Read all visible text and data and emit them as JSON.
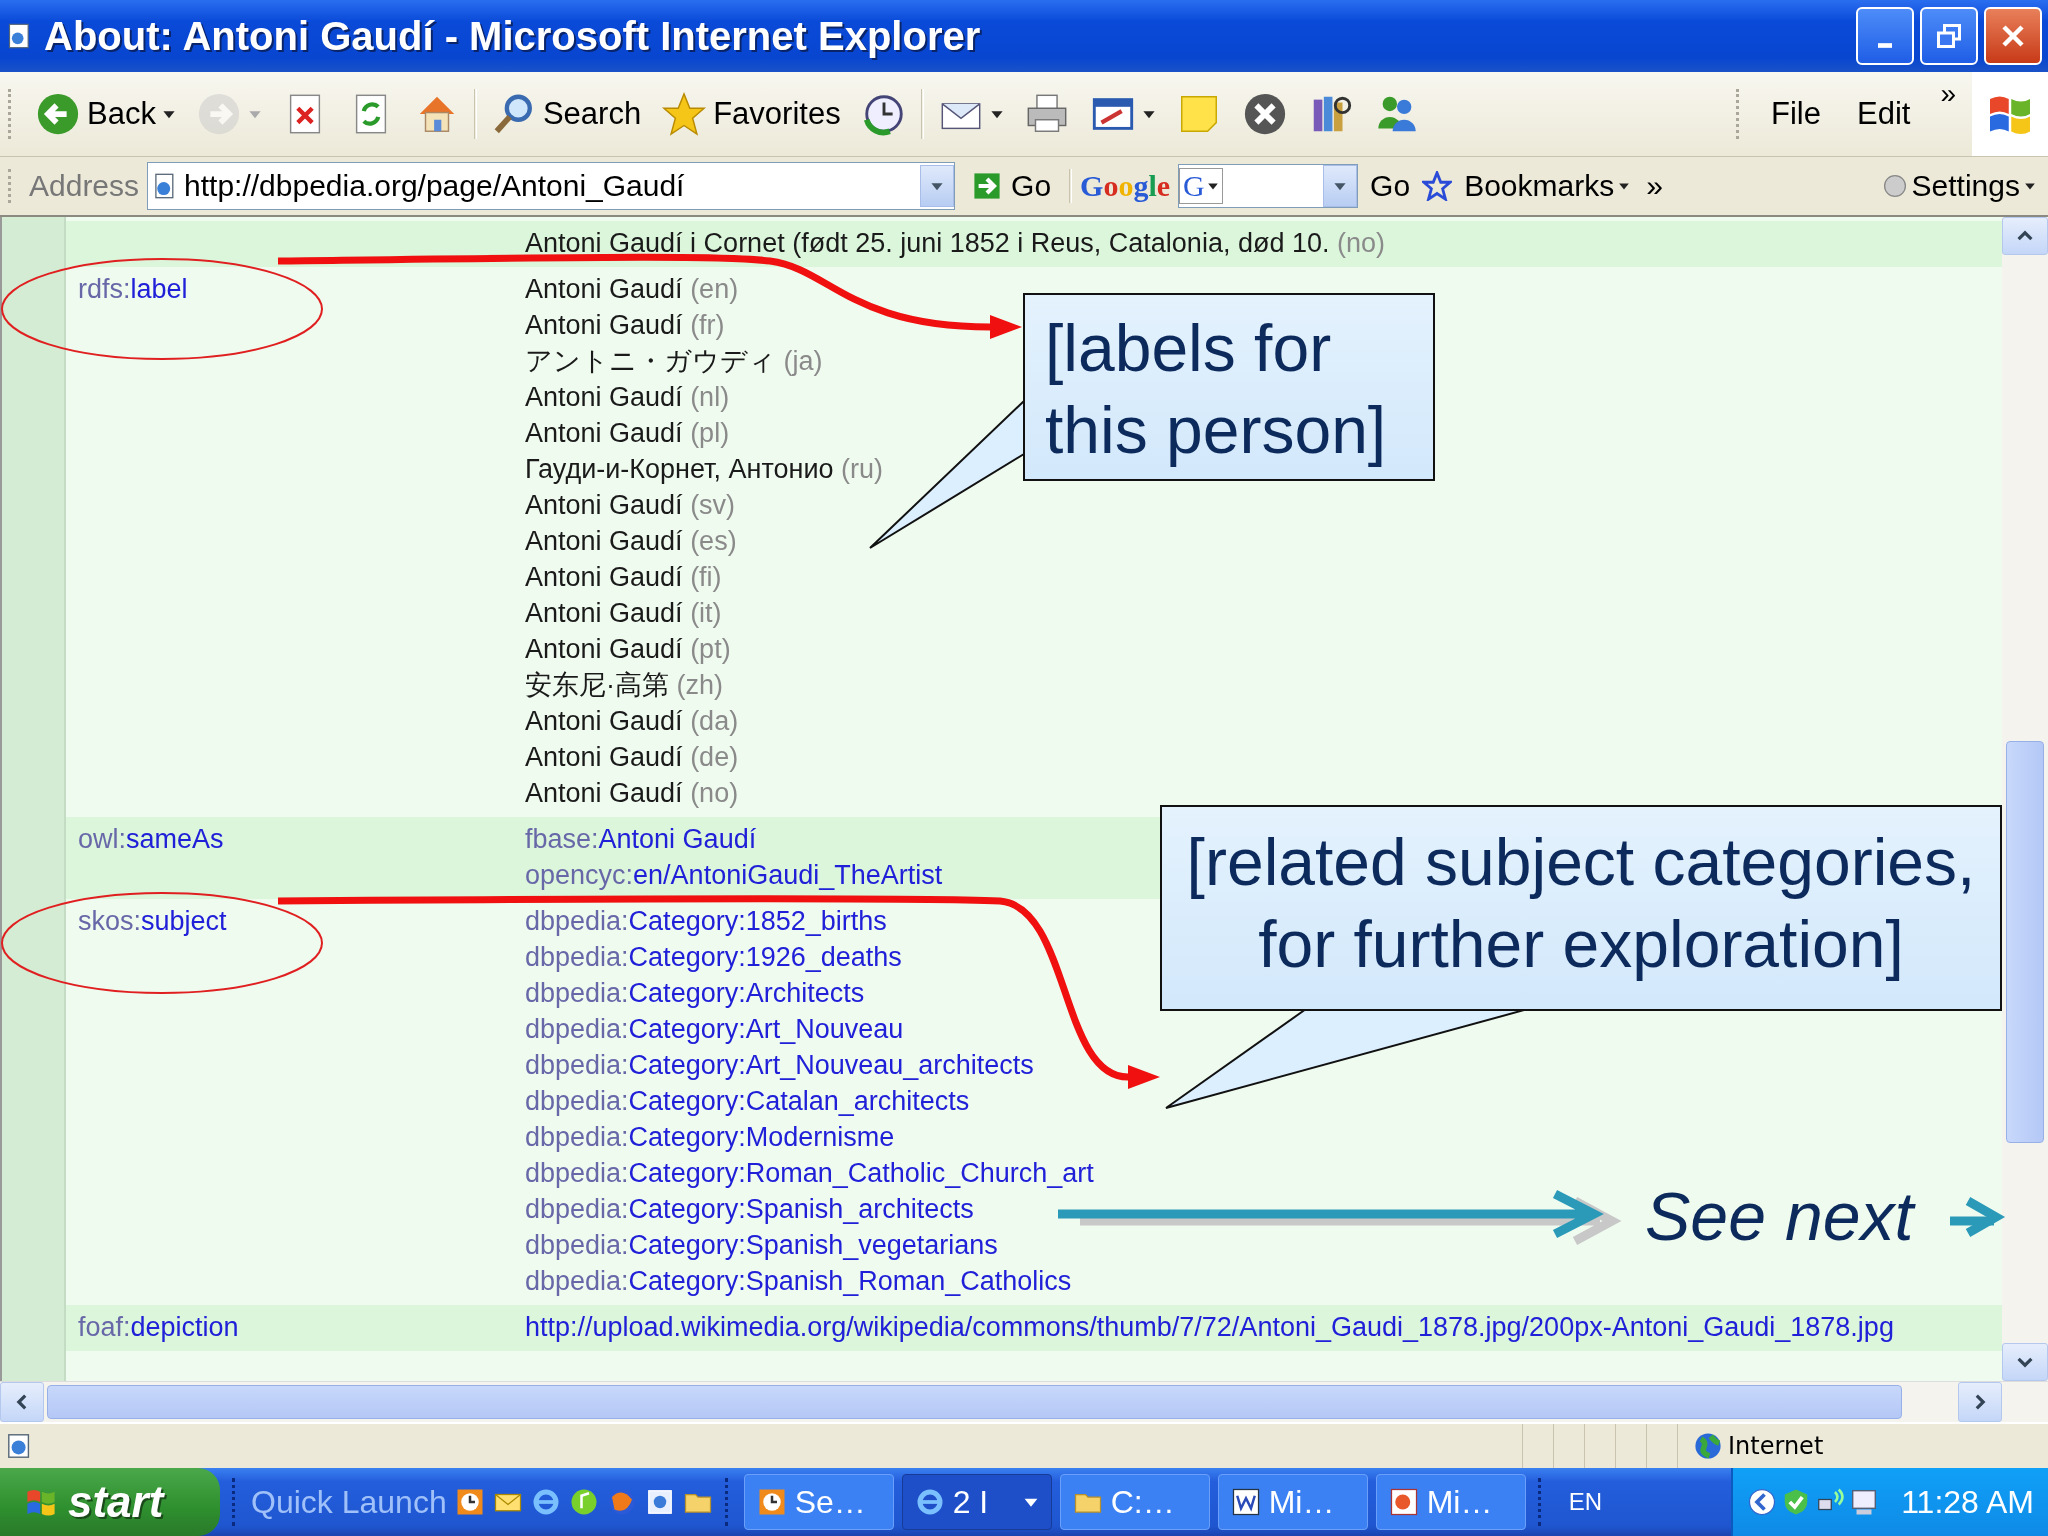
{
  "window": {
    "title": "About: Antoni Gaudí - Microsoft Internet Explorer"
  },
  "toolbar": {
    "buttons": [
      {
        "kind": "back",
        "label": "Back",
        "dropdown": true,
        "disabled": false
      },
      {
        "kind": "forward",
        "dropdown": true,
        "disabled": true
      },
      {
        "kind": "stop",
        "disabled": false
      },
      {
        "kind": "refresh",
        "disabled": false
      },
      {
        "kind": "home",
        "disabled": false
      },
      {
        "kind": "search",
        "label": "Search",
        "disabled": false
      },
      {
        "kind": "favorites",
        "label": "Favorites",
        "disabled": false
      },
      {
        "kind": "history",
        "disabled": false
      },
      {
        "kind": "mail",
        "dropdown": true,
        "disabled": false
      },
      {
        "kind": "print",
        "disabled": false
      },
      {
        "kind": "edit",
        "dropdown": true,
        "disabled": false
      },
      {
        "kind": "note",
        "disabled": false
      },
      {
        "kind": "block",
        "disabled": false
      },
      {
        "kind": "research",
        "disabled": false
      },
      {
        "kind": "messenger",
        "disabled": false
      }
    ],
    "menus": [
      "File",
      "Edit"
    ],
    "more": "»"
  },
  "address": {
    "label": "Address",
    "value": "http://dbpedia.org/page/Antoni_Gaudí",
    "go": "Go"
  },
  "google_toolbar": {
    "logo": "Google",
    "search_menu": "G",
    "go": "Go",
    "bookmarks": "Bookmarks",
    "more": "»",
    "settings": "Settings"
  },
  "rows": [
    {
      "kind": "literal",
      "values": [
        {
          "text": "Antoni Gaudí i Cornet (født 25. juni 1852 i Reus, Catalonia, død 10.",
          "lang": "(no)"
        }
      ]
    },
    {
      "kind": "literal",
      "property": {
        "prefix": "rdfs:",
        "local": "label"
      },
      "values": [
        {
          "text": "Antoni Gaudí",
          "lang": "(en)"
        },
        {
          "text": "Antoni Gaudí",
          "lang": "(fr)"
        },
        {
          "text": "アントニ・ガウディ",
          "lang": "(ja)"
        },
        {
          "text": "Antoni Gaudí",
          "lang": "(nl)"
        },
        {
          "text": "Antoni Gaudí",
          "lang": "(pl)"
        },
        {
          "text": "Гауди-и-Корнет, Антонио",
          "lang": "(ru)"
        },
        {
          "text": "Antoni Gaudí",
          "lang": "(sv)"
        },
        {
          "text": "Antoni Gaudí",
          "lang": "(es)"
        },
        {
          "text": "Antoni Gaudí",
          "lang": "(fi)"
        },
        {
          "text": "Antoni Gaudí",
          "lang": "(it)"
        },
        {
          "text": "Antoni Gaudí",
          "lang": "(pt)"
        },
        {
          "text": "安东尼·高第",
          "lang": "(zh)"
        },
        {
          "text": "Antoni Gaudí",
          "lang": "(da)"
        },
        {
          "text": "Antoni Gaudí",
          "lang": "(de)"
        },
        {
          "text": "Antoni Gaudí",
          "lang": "(no)"
        }
      ]
    },
    {
      "kind": "link",
      "property": {
        "prefix": "owl:",
        "local": "sameAs"
      },
      "values": [
        {
          "prefix": "fbase:",
          "local": "Antoni Gaudí"
        },
        {
          "prefix": "opencyc:",
          "local": "en/AntoniGaudi_TheArtist"
        }
      ]
    },
    {
      "kind": "link",
      "property": {
        "prefix": "skos:",
        "local": "subject"
      },
      "values": [
        {
          "prefix": "dbpedia:",
          "local": "Category:1852_births"
        },
        {
          "prefix": "dbpedia:",
          "local": "Category:1926_deaths"
        },
        {
          "prefix": "dbpedia:",
          "local": "Category:Architects"
        },
        {
          "prefix": "dbpedia:",
          "local": "Category:Art_Nouveau"
        },
        {
          "prefix": "dbpedia:",
          "local": "Category:Art_Nouveau_architects"
        },
        {
          "prefix": "dbpedia:",
          "local": "Category:Catalan_architects"
        },
        {
          "prefix": "dbpedia:",
          "local": "Category:Modernisme"
        },
        {
          "prefix": "dbpedia:",
          "local": "Category:Roman_Catholic_Church_art"
        },
        {
          "prefix": "dbpedia:",
          "local": "Category:Spanish_architects"
        },
        {
          "prefix": "dbpedia:",
          "local": "Category:Spanish_vegetarians"
        },
        {
          "prefix": "dbpedia:",
          "local": "Category:Spanish_Roman_Catholics"
        }
      ]
    },
    {
      "kind": "url",
      "property": {
        "prefix": "foaf:",
        "local": "depiction"
      },
      "values": [
        {
          "text": "http://upload.wikimedia.org/wikipedia/commons/thumb/7/72/Antoni_Gaudi_1878.jpg/200px-Antoni_Gaudi_1878.jpg"
        }
      ]
    }
  ],
  "annotations": {
    "callouts": [
      {
        "lines": [
          "[labels for",
          "this person]"
        ]
      },
      {
        "lines": [
          "[related subject categories,",
          "for further exploration]"
        ]
      }
    ],
    "next": "See next"
  },
  "status_bar": {
    "zone": "Internet"
  },
  "taskbar": {
    "start": "start",
    "quick_launch": "Quick Launch",
    "tasks": [
      {
        "kind": "clock",
        "label": "Se…",
        "selected": false,
        "dropdown": false
      },
      {
        "kind": "ie",
        "label": "2 I",
        "selected": true,
        "dropdown": true
      },
      {
        "kind": "folder",
        "label": "C:…",
        "selected": false,
        "dropdown": false
      },
      {
        "kind": "word",
        "label": "Mi…",
        "selected": false,
        "dropdown": false
      },
      {
        "kind": "ppt",
        "label": "Mi…",
        "selected": false,
        "dropdown": false
      }
    ],
    "language": "EN",
    "clock": "11:28 AM"
  }
}
